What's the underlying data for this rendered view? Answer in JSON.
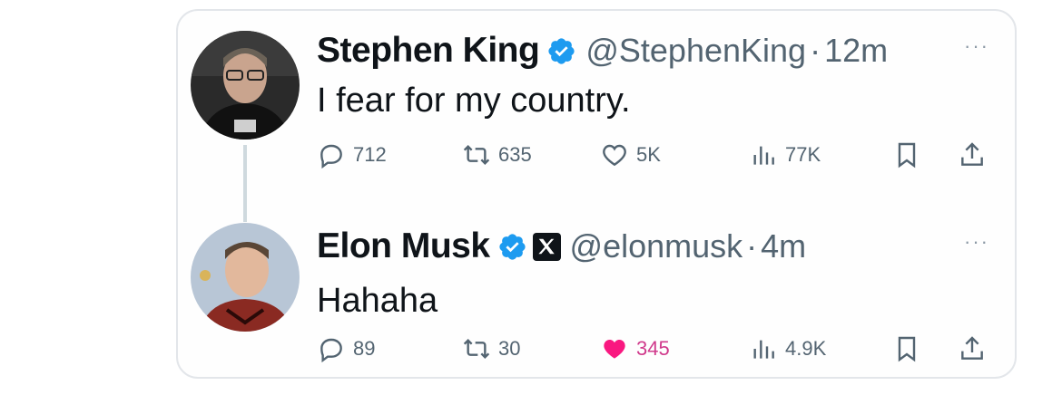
{
  "tweets": [
    {
      "name": "Stephen King",
      "handle": "@StephenKing",
      "separator": "·",
      "time": "12m",
      "more": "···",
      "text": "I fear for my country.",
      "verified": true,
      "affiliate_badge": false,
      "liked": false,
      "counts": {
        "replies": "712",
        "retweets": "635",
        "likes": "5K",
        "views": "77K"
      }
    },
    {
      "name": "Elon Musk",
      "handle": "@elonmusk",
      "separator": "·",
      "time": "4m",
      "more": "···",
      "text": "Hahaha",
      "verified": true,
      "affiliate_badge": true,
      "affiliate_icon": "x-logo-icon",
      "liked": true,
      "counts": {
        "replies": "89",
        "retweets": "30",
        "likes": "345",
        "views": "4.9K"
      }
    }
  ],
  "colors": {
    "verified": "#1d9bf0",
    "like_active": "#f91880",
    "muted": "#536471",
    "thread_line": "#cfd9de"
  },
  "icons": [
    "reply-icon",
    "retweet-icon",
    "like-icon",
    "views-icon",
    "bookmark-icon",
    "share-icon",
    "verified-badge-icon",
    "more-icon"
  ]
}
